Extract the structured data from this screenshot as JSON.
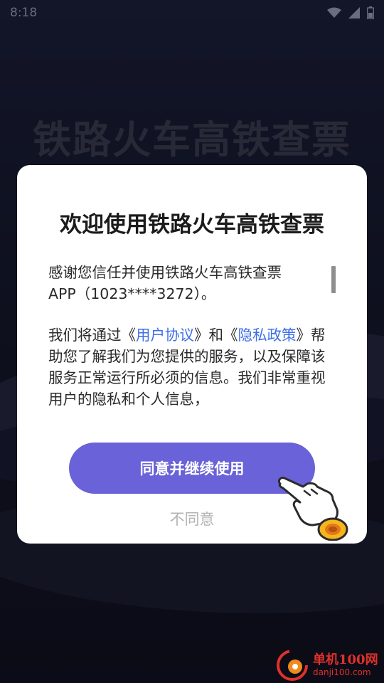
{
  "status_bar": {
    "time": "8:18"
  },
  "background": {
    "title": "铁路火车高铁查票"
  },
  "dialog": {
    "title": "欢迎使用铁路火车高铁查票",
    "para1_line1": "感谢您信任并使用铁路火车高铁查票",
    "para1_line2": "APP（1023****3272）。",
    "para2_prefix": "我们将通过《",
    "link_user_agreement": "用户协议",
    "para2_mid": "》和《",
    "link_privacy_policy": "隐私政策",
    "para2_suffix": "》帮助您了解我们为您提供的服务，以及保障该服务正常运行所必须的信息。我们非常重视用户的隐私和个人信息，",
    "agree_button": "同意并继续使用",
    "disagree_button": "不同意"
  },
  "watermark": {
    "main": "单机100网",
    "sub": "danji100.com"
  },
  "colors": {
    "accent": "#6a62d8",
    "link": "#3d6ee8",
    "watermark": "#e0302a"
  },
  "icons": [
    "wifi-icon",
    "signal-icon",
    "battery-icon",
    "pointing-hand-icon",
    "watermark-logo-icon"
  ]
}
